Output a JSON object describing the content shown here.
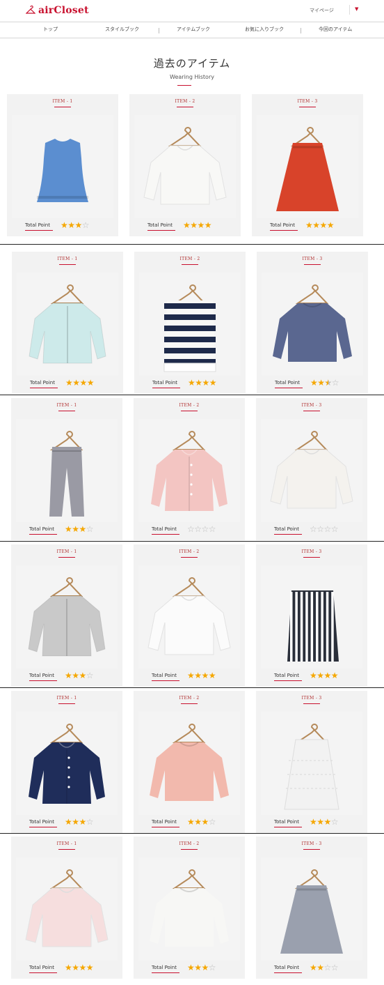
{
  "header": {
    "logo_text": "airCloset",
    "mypage_label": "マイページ",
    "caret": "▼",
    "brand_color": "#c8102e"
  },
  "nav": {
    "items": [
      "トップ",
      "スタイルブック",
      "アイテムブック",
      "お気に入りブック",
      "今回のアイテム"
    ]
  },
  "page": {
    "title": "過去のアイテム",
    "subtitle": "Wearing History"
  },
  "total_point_label": "Total Point",
  "rows": [
    {
      "items": [
        {
          "label": "ITEM - 1",
          "rating": 3,
          "garment": "vest",
          "color": "#5b8ed0"
        },
        {
          "label": "ITEM - 2",
          "rating": 4.5,
          "garment": "blouse",
          "color": "#f8f8f6"
        },
        {
          "label": "ITEM - 3",
          "rating": 4,
          "garment": "skirt-flare",
          "color": "#d8432a"
        }
      ]
    },
    {
      "items": [
        {
          "label": "ITEM - 1",
          "rating": 4,
          "garment": "jacket",
          "color": "#cdeaea"
        },
        {
          "label": "ITEM - 2",
          "rating": 4,
          "garment": "skirt-stripe",
          "color": "#1e2a4a"
        },
        {
          "label": "ITEM - 3",
          "rating": 2.5,
          "garment": "sweater",
          "color": "#5a6790"
        }
      ]
    },
    {
      "items": [
        {
          "label": "ITEM - 1",
          "rating": 3,
          "garment": "pants",
          "color": "#9a9aa4"
        },
        {
          "label": "ITEM - 2",
          "rating": 0,
          "garment": "cardigan",
          "color": "#f3c5c2"
        },
        {
          "label": "ITEM - 3",
          "rating": 0,
          "garment": "blouse",
          "color": "#f4f2ee"
        }
      ]
    },
    {
      "items": [
        {
          "label": "ITEM - 1",
          "rating": 3,
          "garment": "jacket",
          "color": "#c9c9c9"
        },
        {
          "label": "ITEM - 2",
          "rating": 4,
          "garment": "blouse",
          "color": "#fbfbfb"
        },
        {
          "label": "ITEM - 3",
          "rating": 4.5,
          "garment": "skirt-pencil-stripe",
          "color": "#2a2f3a"
        }
      ]
    },
    {
      "items": [
        {
          "label": "ITEM - 1",
          "rating": 3,
          "garment": "cardigan",
          "color": "#1f2d5a"
        },
        {
          "label": "ITEM - 2",
          "rating": 3,
          "garment": "sweater",
          "color": "#f2b9ad"
        },
        {
          "label": "ITEM - 3",
          "rating": 3,
          "garment": "skirt-lace",
          "color": "#f2f2f2"
        }
      ]
    },
    {
      "items": [
        {
          "label": "ITEM - 1",
          "rating": 4,
          "garment": "blouse",
          "color": "#f6dede"
        },
        {
          "label": "ITEM - 2",
          "rating": 3,
          "garment": "sweater",
          "color": "#f7f7f5"
        },
        {
          "label": "ITEM - 3",
          "rating": 2,
          "garment": "skirt-flare",
          "color": "#9aa0ae"
        }
      ]
    }
  ]
}
